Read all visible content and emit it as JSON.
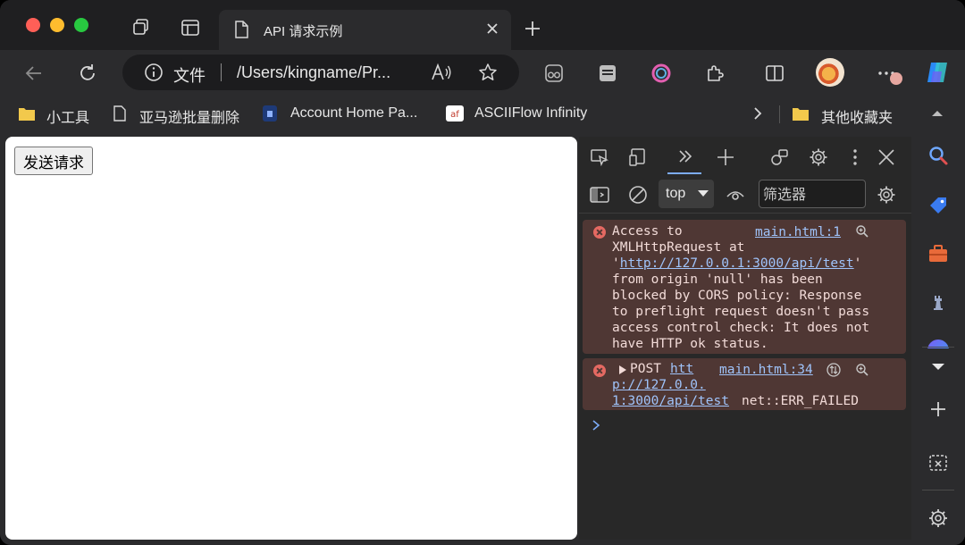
{
  "tab": {
    "title": "API 请求示例"
  },
  "omnibox": {
    "scheme_label": "文件",
    "url": "/Users/kingname/Pr..."
  },
  "bookmarks": [
    {
      "label": "小工具",
      "icon": "folder-icon"
    },
    {
      "label": "亚马逊批量删除",
      "icon": "page-icon"
    },
    {
      "label": "Account Home Pa...",
      "icon": "account-icon"
    },
    {
      "label": "ASCIIFlow Infinity",
      "icon": "asciiflow-icon"
    },
    {
      "label": "其他收藏夹",
      "icon": "folder-icon"
    }
  ],
  "page": {
    "send_button": "发送请求"
  },
  "devtools": {
    "context": "top",
    "filter_placeholder": "筛选器",
    "messages": [
      {
        "lines": [
          "Access to",
          "XMLHttpRequest at",
          "'",
          "from origin 'null' has been",
          "blocked by CORS policy: Response",
          "to preflight request doesn't pass",
          "access control check: It does not",
          "have HTTP ok status."
        ],
        "url": "http://127.0.0.1:3000/api/test",
        "url_suffix": "'",
        "source": "main.html:1"
      },
      {
        "method": "POST",
        "url_parts": [
          "htt",
          "p://127.0.0.",
          "1:3000/api/test"
        ],
        "suffix": "net::ERR_FAILED",
        "source": "main.html:34"
      }
    ]
  },
  "colors": {
    "accent": "#7cacf8",
    "error_bg": "#4f3734",
    "error_icon": "#e46962"
  }
}
